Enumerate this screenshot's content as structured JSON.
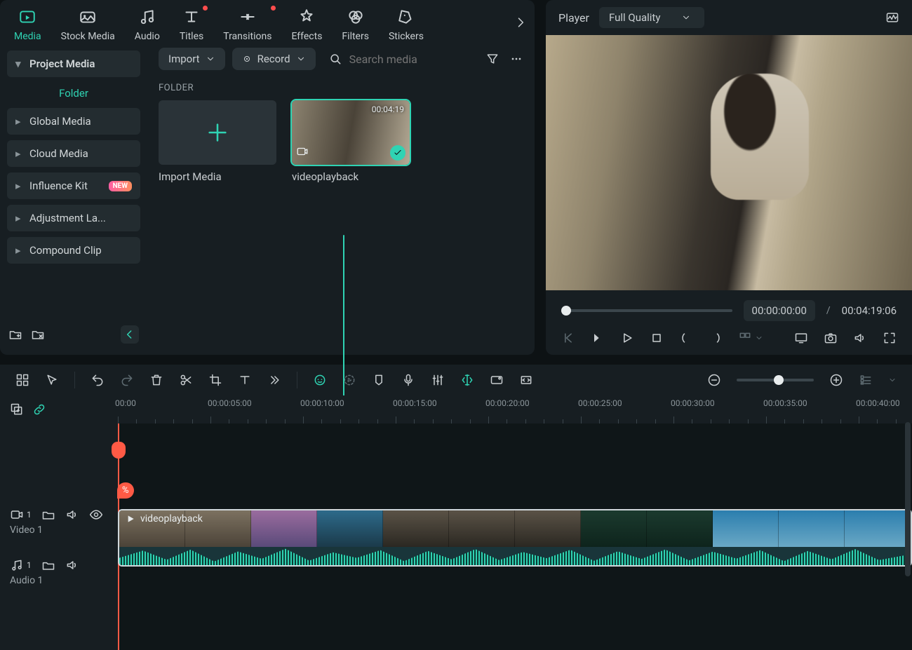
{
  "tabs": [
    {
      "id": "media",
      "label": "Media"
    },
    {
      "id": "stock",
      "label": "Stock Media"
    },
    {
      "id": "audio",
      "label": "Audio"
    },
    {
      "id": "titles",
      "label": "Titles",
      "dot": true
    },
    {
      "id": "transitions",
      "label": "Transitions",
      "dot": true
    },
    {
      "id": "effects",
      "label": "Effects"
    },
    {
      "id": "filters",
      "label": "Filters"
    },
    {
      "id": "stickers",
      "label": "Stickers"
    }
  ],
  "sidebar": {
    "project_media": "Project Media",
    "folder": "Folder",
    "items": [
      {
        "label": "Global Media"
      },
      {
        "label": "Cloud Media"
      },
      {
        "label": "Influence Kit",
        "badge": "NEW"
      },
      {
        "label": "Adjustment La..."
      },
      {
        "label": "Compound Clip"
      }
    ]
  },
  "content": {
    "import": "Import",
    "record": "Record",
    "search_placeholder": "Search media",
    "section": "FOLDER",
    "import_card": "Import Media",
    "clip_name": "videoplayback",
    "clip_dur": "00:04:19"
  },
  "player": {
    "title": "Player",
    "quality": "Full Quality",
    "current": "00:00:00:00",
    "sep": "/",
    "total": "00:04:19:06"
  },
  "ruler": [
    "00:00",
    "00:00:05:00",
    "00:00:10:00",
    "00:00:15:00",
    "00:00:20:00",
    "00:00:25:00",
    "00:00:30:00",
    "00:00:35:00",
    "00:00:40:00"
  ],
  "tracks": {
    "video_index": "1",
    "video_label": "Video 1",
    "audio_index": "1",
    "audio_label": "Audio 1",
    "clip_title": "videoplayback",
    "playhead_pct": "%"
  }
}
